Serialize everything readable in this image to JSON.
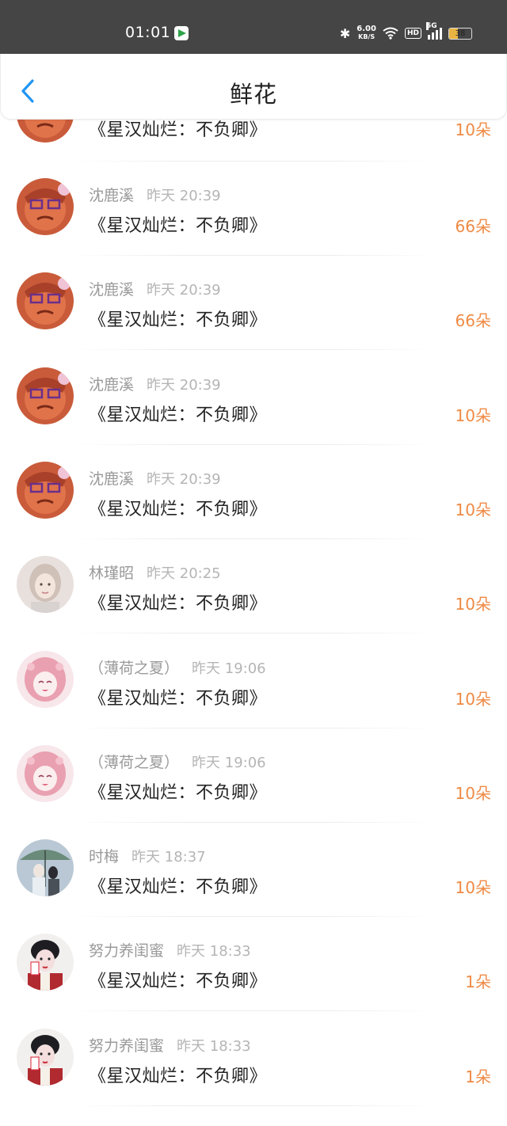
{
  "status_bar": {
    "time": "01:01",
    "net_speed_value": "6.00",
    "net_speed_unit": "KB/S",
    "hd": "HD",
    "network": "5G",
    "battery": "38",
    "battery_level": 0.38
  },
  "header": {
    "title": "鲜花"
  },
  "colors": {
    "accent": "#2196f3",
    "amount": "#ef8a45",
    "status_bar": "#454545"
  },
  "partial_top": {
    "book": "《星汉灿烂：不负卿》",
    "amount": "10朵"
  },
  "rows": [
    {
      "sender": "沈鹿溪",
      "time": "昨天 20:39",
      "book": "《星汉灿烂：不负卿》",
      "amount": "66朵",
      "avatar": "cartoon-avatar"
    },
    {
      "sender": "沈鹿溪",
      "time": "昨天 20:39",
      "book": "《星汉灿烂：不负卿》",
      "amount": "66朵",
      "avatar": "cartoon-avatar"
    },
    {
      "sender": "沈鹿溪",
      "time": "昨天 20:39",
      "book": "《星汉灿烂：不负卿》",
      "amount": "10朵",
      "avatar": "cartoon-avatar"
    },
    {
      "sender": "沈鹿溪",
      "time": "昨天 20:39",
      "book": "《星汉灿烂：不负卿》",
      "amount": "10朵",
      "avatar": "cartoon-avatar"
    },
    {
      "sender": "林瑾昭",
      "time": "昨天 20:25",
      "book": "《星汉灿烂：不负卿》",
      "amount": "10朵",
      "avatar": "portrait-avatar"
    },
    {
      "sender": "（薄荷之夏）",
      "time": "昨天 19:06",
      "book": "《星汉灿烂：不负卿》",
      "amount": "10朵",
      "avatar": "anime-avatar"
    },
    {
      "sender": "（薄荷之夏）",
      "time": "昨天 19:06",
      "book": "《星汉灿烂：不负卿》",
      "amount": "10朵",
      "avatar": "anime-avatar"
    },
    {
      "sender": "时梅",
      "time": "昨天 18:37",
      "book": "《星汉灿烂：不负卿》",
      "amount": "10朵",
      "avatar": "umbrella-avatar"
    },
    {
      "sender": "努力养闺蜜",
      "time": "昨天 18:33",
      "book": "《星汉灿烂：不负卿》",
      "amount": "1朵",
      "avatar": "costume-avatar"
    },
    {
      "sender": "努力养闺蜜",
      "time": "昨天 18:33",
      "book": "《星汉灿烂：不负卿》",
      "amount": "1朵",
      "avatar": "costume-avatar"
    }
  ]
}
